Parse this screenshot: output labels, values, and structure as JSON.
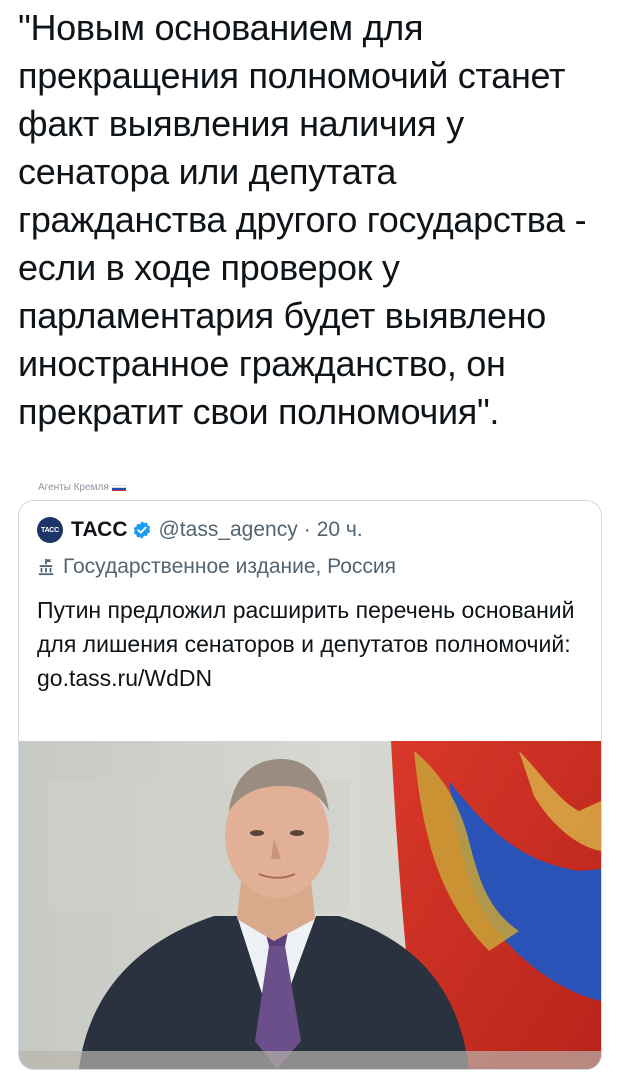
{
  "tweet": {
    "text": "\"Новым основанием для прекращения полномочий станет факт выявления наличия у сенатора или депутата гражданства другого государства - если в ходе проверок у парламентария будет выявлено иностранное гражданство, он прекратит свои полномочия\"."
  },
  "watermark": {
    "text": "Агенты Кремля"
  },
  "quoted_tweet": {
    "avatar_text": "ТАСС",
    "name": "ТАСС",
    "handle": "@tass_agency",
    "separator": "·",
    "time": "20 ч.",
    "label": "Государственное издание, Россия",
    "text": "Путин предложил расширить перечень оснований для лишения сенаторов и депутатов полномочий:",
    "link": "go.tass.ru/WdDN"
  },
  "icons": {
    "verified": "verified-badge-icon",
    "government": "government-building-icon",
    "flag": "russia-flag-icon"
  },
  "colors": {
    "text": "#0f1419",
    "secondary": "#536471",
    "verified": "#1d9bf0",
    "border": "#cfd9de"
  }
}
